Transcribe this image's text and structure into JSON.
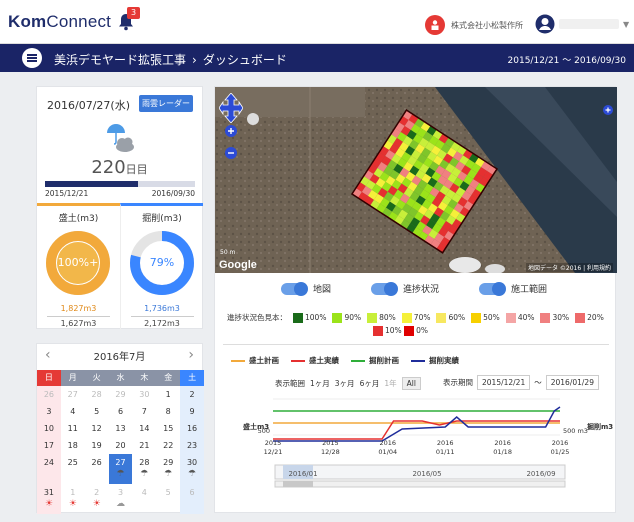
{
  "header": {
    "logo_strong": "Kom",
    "logo_rest": "Connect",
    "notif_count": "3",
    "company": "株式会社小松製作所"
  },
  "nav": {
    "project": "美浜デモヤード拡張工事",
    "sep": "›",
    "page": "ダッシュボード",
    "period": "2015/12/21 ～ 2016/09/30"
  },
  "date_card": {
    "date": "2016/07/27(水)",
    "radar": "雨雲レーダー",
    "day_number": "220",
    "day_unit": "日目",
    "progress_fraction": 0.62,
    "start": "2015/12/21",
    "end": "2016/09/30",
    "fill": {
      "title": "盛土(m3)",
      "pct": "100%+",
      "fraction": 1.0,
      "actual": "1,827m3",
      "plan": "1,627m3",
      "color": "#f2a93b"
    },
    "cut": {
      "title": "掘削(m3)",
      "pct": "79%",
      "fraction": 0.79,
      "actual": "1,736m3",
      "plan": "2,172m3",
      "color": "#3a86ff"
    }
  },
  "calendar": {
    "title": "2016年7月",
    "prev": "‹",
    "next": "›",
    "weekdays": [
      "日",
      "月",
      "火",
      "水",
      "木",
      "金",
      "土"
    ],
    "days": [
      [
        "26",
        "27",
        "28",
        "29",
        "30",
        "1",
        "2"
      ],
      [
        "3",
        "4",
        "5",
        "6",
        "7",
        "8",
        "9"
      ],
      [
        "10",
        "11",
        "12",
        "13",
        "14",
        "15",
        "16"
      ],
      [
        "17",
        "18",
        "19",
        "20",
        "21",
        "22",
        "23"
      ],
      [
        "24",
        "25",
        "26",
        "27",
        "28",
        "29",
        "30"
      ],
      [
        "31",
        "1",
        "2",
        "3",
        "4",
        "5",
        "6"
      ]
    ]
  },
  "map": {
    "google": "Google",
    "attribution": "地図データ ©2016 | 利用規約",
    "scale": "50 m"
  },
  "toggles": [
    {
      "label": "地図"
    },
    {
      "label": "進捗状況"
    },
    {
      "label": "施工範囲"
    }
  ],
  "legend": {
    "title": "進捗状況色見本：",
    "items": [
      {
        "c": "#1a6b1a",
        "t": "100%"
      },
      {
        "c": "#9be31a",
        "t": "90%"
      },
      {
        "c": "#c8ef3a",
        "t": "80%"
      },
      {
        "c": "#f5f03a",
        "t": "70%"
      },
      {
        "c": "#f7e860",
        "t": "60%"
      },
      {
        "c": "#f7d000",
        "t": "50%"
      },
      {
        "c": "#f4a5a5",
        "t": "40%"
      },
      {
        "c": "#f08080",
        "t": "30%"
      },
      {
        "c": "#ee6a6a",
        "t": "20%"
      },
      {
        "c": "#e53030",
        "t": "10%"
      },
      {
        "c": "#e00000",
        "t": "0%"
      }
    ]
  },
  "chart_controls": {
    "label": "表示範囲",
    "r1": "1ヶ月",
    "r3": "3ヶ月",
    "r6": "6ヶ月",
    "r1y": "1年",
    "all": "All",
    "period_label": "表示期間",
    "from": "2015/12/21",
    "tilde": "～",
    "to": "2016/01/29"
  },
  "chart_data": {
    "type": "line",
    "series": [
      {
        "name": "盛土計画",
        "color": "#f2a93b"
      },
      {
        "name": "盛土実績",
        "color": "#e53030"
      },
      {
        "name": "掘削計画",
        "color": "#2fae3a"
      },
      {
        "name": "掘削実績",
        "color": "#1f2d9b"
      }
    ],
    "x_ticks": [
      [
        "2015",
        "12/21"
      ],
      [
        "2015",
        "12/28"
      ],
      [
        "2016",
        "01/04"
      ],
      [
        "2016",
        "01/11"
      ],
      [
        "2016",
        "01/18"
      ],
      [
        "2016",
        "01/25"
      ]
    ],
    "y_left_label": "盛土m3",
    "y_right_label": "掘削m3",
    "y_left_tick": "500",
    "y_right_tick": "500 m3",
    "navigator": {
      "ticks": [
        "2016/01",
        "2016/05",
        "2016/09"
      ]
    }
  }
}
